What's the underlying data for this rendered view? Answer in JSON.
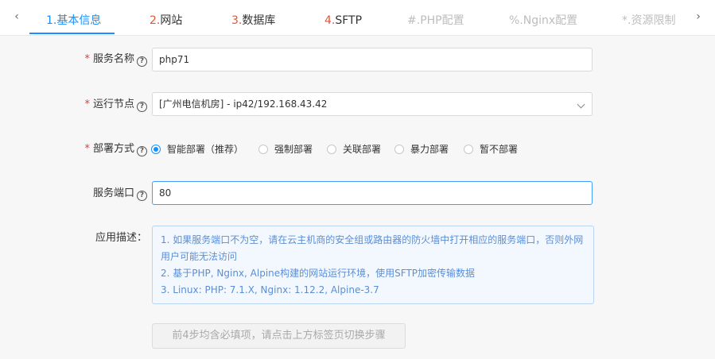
{
  "tabs": [
    {
      "num": "1.",
      "name": "基本信息",
      "state": "active"
    },
    {
      "num": "2.",
      "name": "网站",
      "state": "normal"
    },
    {
      "num": "3.",
      "name": "数据库",
      "state": "normal"
    },
    {
      "num": "4.",
      "name": "SFTP",
      "state": "normal"
    },
    {
      "num": "#.",
      "name": "PHP配置",
      "state": "disabled"
    },
    {
      "num": "%.",
      "name": "Nginx配置",
      "state": "disabled"
    },
    {
      "num": "*.",
      "name": "资源限制",
      "state": "disabled"
    }
  ],
  "tab_nav": {
    "prev_icon": "‹",
    "next_icon": "›"
  },
  "form": {
    "service_name": {
      "required_mark": "*",
      "label": "服务名称",
      "help": "?",
      "value": "php71"
    },
    "run_node": {
      "required_mark": "*",
      "label": "运行节点",
      "help": "?",
      "value": "[广州电信机房] - ip42/192.168.43.42"
    },
    "deploy_mode": {
      "required_mark": "*",
      "label": "部署方式",
      "help": "?",
      "options": [
        {
          "label": "智能部署（推荐）",
          "checked": true
        },
        {
          "label": "强制部署",
          "checked": false
        },
        {
          "label": "关联部署",
          "checked": false
        },
        {
          "label": "暴力部署",
          "checked": false
        },
        {
          "label": "暂不部署",
          "checked": false
        }
      ]
    },
    "service_port": {
      "label": "服务端口",
      "help": "?",
      "value": "80"
    },
    "app_desc": {
      "label": "应用描述：",
      "lines": [
        "1. 如果服务端口不为空，请在云主机商的安全组或路由器的防火墙中打开相应的服务端口，否则外网",
        "用户可能无法访问",
        "2. 基于PHP, Nginx, Alpine构建的网站运行环境，使用SFTP加密传输数据",
        "3. Linux: PHP: 7.1.X, Nginx: 1.12.2, Alpine-3.7"
      ]
    },
    "submit_label": "前4步均含必填项，请点击上方标签页切换步骤"
  },
  "colors": {
    "accent": "#1890ff",
    "tab_number": "#e2553b",
    "required": "#e23d3d",
    "desc_text": "#5b8ed6"
  }
}
